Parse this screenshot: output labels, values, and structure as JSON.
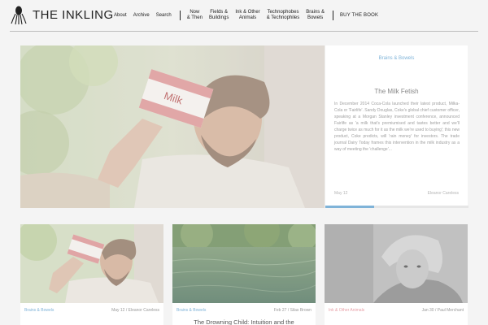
{
  "brand": {
    "name": "THE INKLING",
    "logo_icon": "squid-icon"
  },
  "nav": {
    "items": [
      {
        "label": "About"
      },
      {
        "label": "Archive"
      },
      {
        "label": "Search"
      }
    ],
    "sections": [
      {
        "line1": "Now",
        "line2": "& Then"
      },
      {
        "line1": "Fields &",
        "line2": "Buildings"
      },
      {
        "line1": "Ink & Other",
        "line2": "Animals"
      },
      {
        "line1": "Technophobes",
        "line2": "& Technophiles"
      },
      {
        "line1": "Brains &",
        "line2": "Bowels"
      }
    ],
    "cta": "BUY THE BOOK"
  },
  "featured": {
    "category": "Brains & Bowels",
    "title": "The Milk Fetish",
    "excerpt": "In December 2014 Coca-Cola launched their latest product, Milka-Cola or 'Fairlife'. Sandy Douglas, Coke's global chief customer officer, speaking at a Morgan Stanley investment conference, announced Fairlife as 'a milk that's premiumised and tastes better and we'll charge twice as much for it as the milk we're used to buying'; this new product, Coke predicts, will 'rain money' for investors. The trade journal Dairy Today frames this intervention in the milk industry as a way of meeting the 'challenge'...",
    "date": "May 12",
    "author": "Eleanor Careless",
    "progress": 0.34,
    "image_text": "Milk",
    "image_alt": "man-drinking-milk-photo"
  },
  "cards": [
    {
      "category": "Brains & Bowels",
      "date": "May 12",
      "author": "Eleanor Careless",
      "title": "",
      "category_color": "#7fb3d8",
      "image": "man-drinking-milk-photo"
    },
    {
      "category": "Brains & Bowels",
      "date": "Feb 27",
      "author": "Silas Brown",
      "title": "The Drowning Child: Intuition and the",
      "category_color": "#7fb3d8",
      "image": "river-water-photo"
    },
    {
      "category": "Ink & Other Animals",
      "date": "Jan 30",
      "author": "Paul Merchant",
      "title": "",
      "category_color": "#e8a0a8",
      "image": "child-headscarf-bw-photo"
    }
  ],
  "separator": "/",
  "colors": {
    "accent_blue": "#7fb3d8",
    "accent_pink": "#e8a0a8",
    "background": "#f4f4f4"
  }
}
